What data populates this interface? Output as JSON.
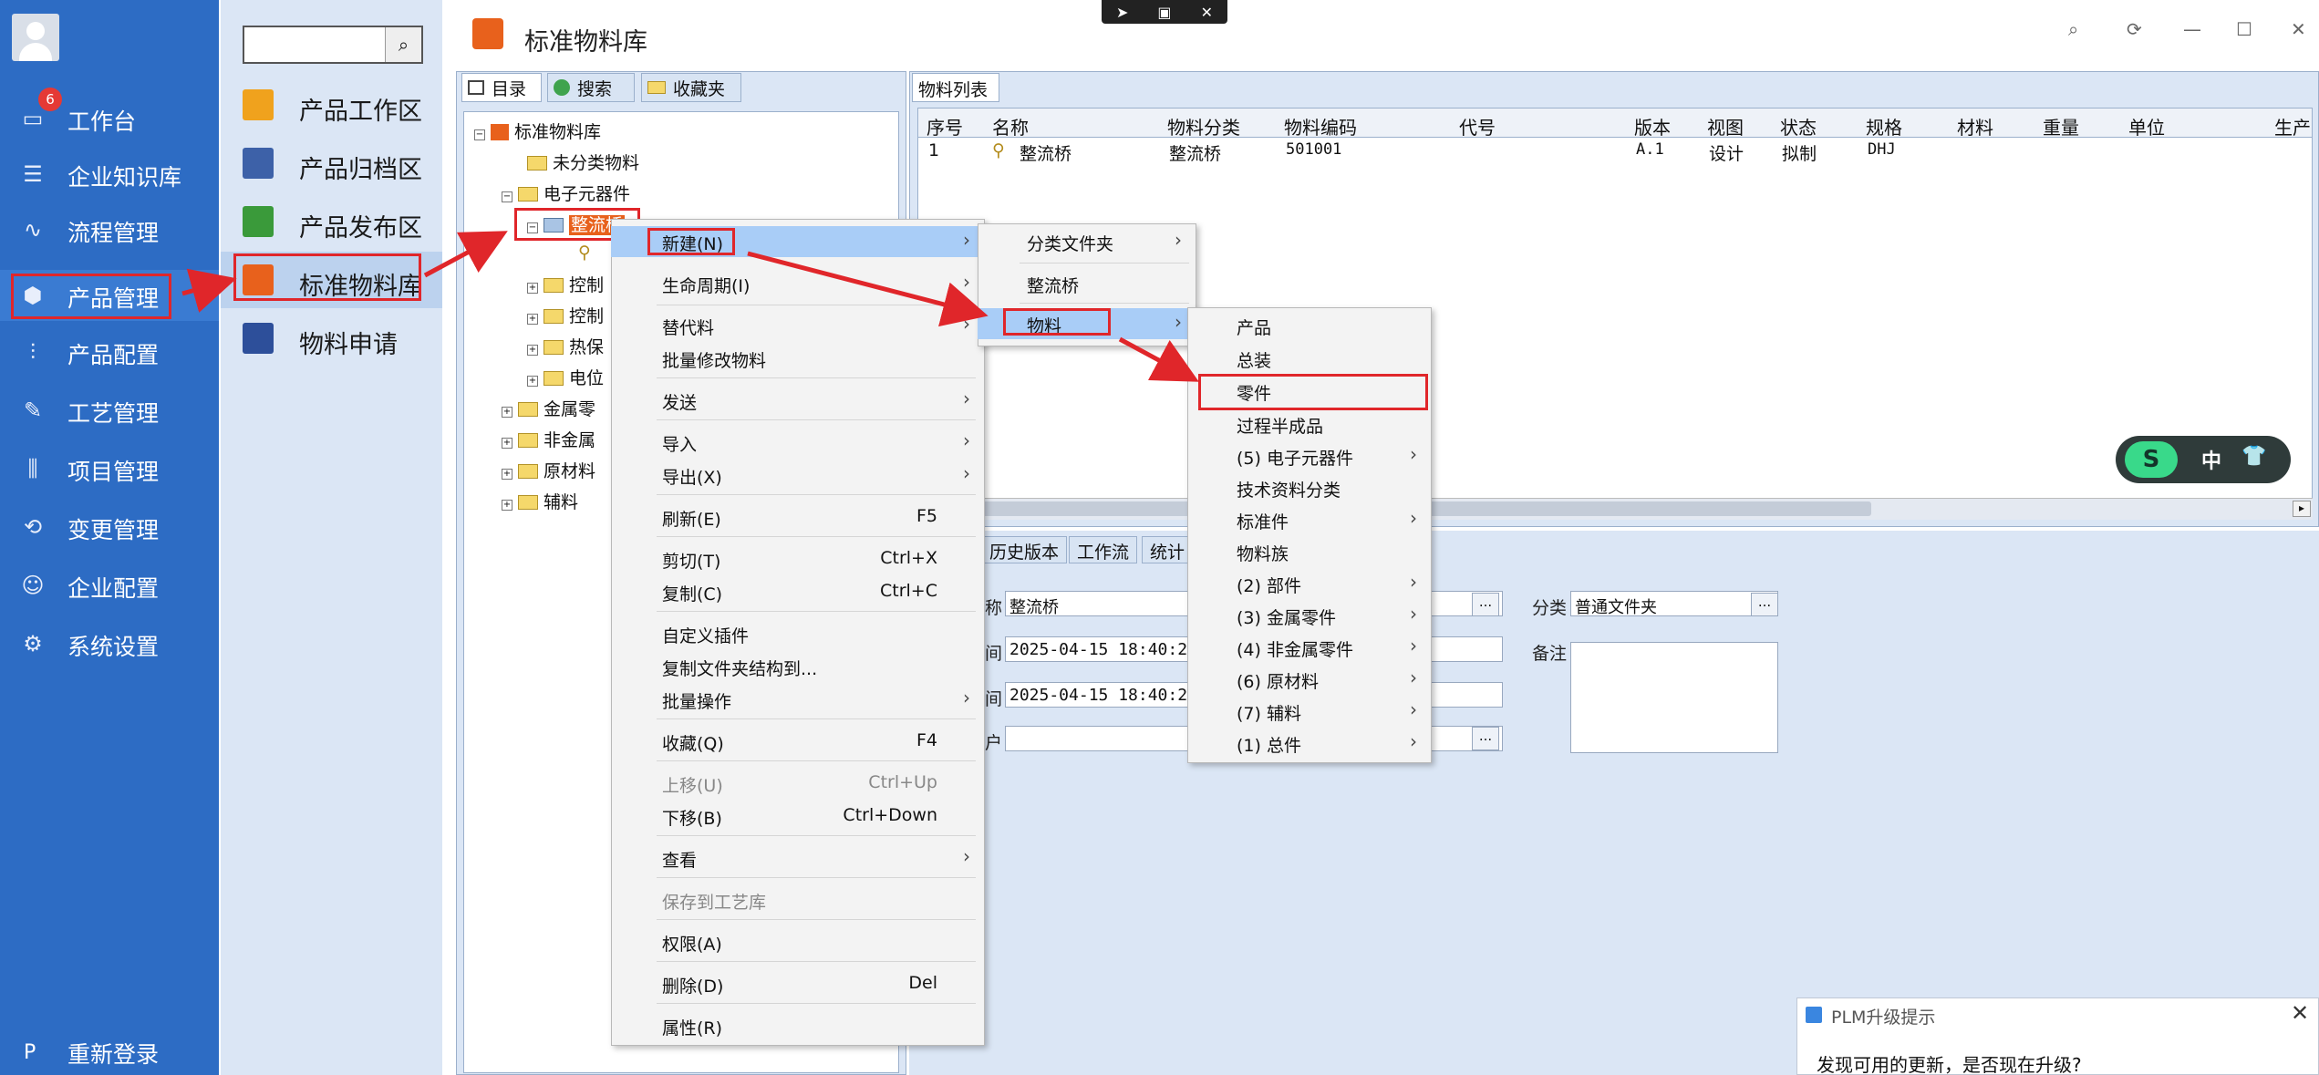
{
  "top_bar": {
    "icons": [
      "send-icon",
      "screen-icon",
      "close-icon"
    ],
    "send": "➤",
    "screen": "▣",
    "close": "✕"
  },
  "left_nav": {
    "badge": "6",
    "items": [
      {
        "label": "工作台",
        "icon": "monitor-icon",
        "glyph": "▭"
      },
      {
        "label": "企业知识库",
        "icon": "book-icon",
        "glyph": "☰"
      },
      {
        "label": "流程管理",
        "icon": "flow-icon",
        "glyph": "∿"
      },
      {
        "label": "产品管理",
        "icon": "cube-icon",
        "glyph": "⬢"
      },
      {
        "label": "产品配置",
        "icon": "sliders-icon",
        "glyph": "⫶"
      },
      {
        "label": "工艺管理",
        "icon": "wrench-icon",
        "glyph": "✎"
      },
      {
        "label": "项目管理",
        "icon": "chart-icon",
        "glyph": "⫼"
      },
      {
        "label": "变更管理",
        "icon": "change-icon",
        "glyph": "⟲"
      },
      {
        "label": "企业配置",
        "icon": "users-icon",
        "glyph": "☺"
      },
      {
        "label": "系统设置",
        "icon": "gear-icon",
        "glyph": "⚙"
      }
    ],
    "logout_icon": "P",
    "logout": "重新登录"
  },
  "sub_nav": {
    "search_value": "",
    "search_icon": "⌕",
    "items": [
      {
        "label": "产品工作区",
        "color": "#f0a21d"
      },
      {
        "label": "产品归档区",
        "color": "#3d61a8"
      },
      {
        "label": "产品发布区",
        "color": "#3a9a3a"
      },
      {
        "label": "标准物料库",
        "color": "#e8611c"
      },
      {
        "label": "物料申请",
        "color": "#2d4f9a"
      }
    ]
  },
  "window": {
    "title": "标准物料库",
    "search": "⌕",
    "refresh": "⟳",
    "minimize": "—",
    "maximize": "☐",
    "close": "✕"
  },
  "tree": {
    "tabs": {
      "dir": "目录",
      "search": "搜索",
      "fav": "收藏夹"
    },
    "root": "标准物料库",
    "nodes": {
      "unclassified": "未分类物料",
      "electronic": "电子元器件",
      "rectifier": "整流桥",
      "ctrl1": "控制",
      "ctrl2": "控制",
      "thermal": "热保",
      "power": "电位",
      "metal": "金属零",
      "nonmetal": "非金属",
      "raw": "原材料",
      "aux": "辅料"
    }
  },
  "list": {
    "tab": "物料列表",
    "columns": [
      "序号",
      "名称",
      "物料分类",
      "物料编码",
      "代号",
      "版本",
      "视图",
      "状态",
      "规格",
      "材料",
      "重量",
      "单位",
      "生产"
    ],
    "rows": [
      [
        "1",
        "整流桥",
        "整流桥",
        "501001",
        "",
        "A.1",
        "设计",
        "拟制",
        "DHJ",
        "",
        "",
        "",
        ""
      ]
    ]
  },
  "detail": {
    "tabs": [
      "历史版本",
      "工作流",
      "统计"
    ],
    "name_label": "称",
    "name_value": "整流桥",
    "created_label": "间",
    "created_value": "2025-04-15 18:40:23",
    "modified_label": "间",
    "modified_value": "2025-04-15 18:40:23",
    "user_label": "户",
    "user_value": "",
    "category_label": "分类",
    "category_value": "普通文件夹",
    "remark_label": "备注",
    "remark_value": "",
    "dots": "..."
  },
  "context_menu": [
    {
      "label": "新建(N)",
      "key": "",
      "arrow": true
    },
    {
      "label": "生命周期(I)",
      "key": "",
      "arrow": true
    },
    {
      "label": "替代料",
      "key": "",
      "arrow": true
    },
    {
      "label": "批量修改物料",
      "key": "",
      "arrow": false
    },
    {
      "label": "发送",
      "key": "",
      "arrow": true
    },
    {
      "label": "导入",
      "key": "",
      "arrow": true
    },
    {
      "label": "导出(X)",
      "key": "",
      "arrow": true
    },
    {
      "label": "刷新(E)",
      "key": "F5",
      "arrow": false
    },
    {
      "label": "剪切(T)",
      "key": "Ctrl+X",
      "arrow": false
    },
    {
      "label": "复制(C)",
      "key": "Ctrl+C",
      "arrow": false
    },
    {
      "label": "自定义插件",
      "key": "",
      "arrow": false
    },
    {
      "label": "复制文件夹结构到...",
      "key": "",
      "arrow": false
    },
    {
      "label": "批量操作",
      "key": "",
      "arrow": true
    },
    {
      "label": "收藏(Q)",
      "key": "F4",
      "arrow": false
    },
    {
      "label": "上移(U)",
      "key": "Ctrl+Up",
      "arrow": false
    },
    {
      "label": "下移(B)",
      "key": "Ctrl+Down",
      "arrow": false
    },
    {
      "label": "查看",
      "key": "",
      "arrow": true
    },
    {
      "label": "保存到工艺库",
      "key": "",
      "arrow": false
    },
    {
      "label": "权限(A)",
      "key": "",
      "arrow": false
    },
    {
      "label": "删除(D)",
      "key": "Del",
      "arrow": false
    },
    {
      "label": "属性(R)",
      "key": "",
      "arrow": false
    }
  ],
  "submenu_new": [
    {
      "label": "分类文件夹",
      "arrow": true
    },
    {
      "label": "整流桥",
      "arrow": false
    },
    {
      "label": "物料",
      "arrow": true
    }
  ],
  "submenu_material": [
    {
      "label": "产品",
      "arrow": false
    },
    {
      "label": "总装",
      "arrow": false
    },
    {
      "label": "零件",
      "arrow": false
    },
    {
      "label": "过程半成品",
      "arrow": false
    },
    {
      "label": "(5) 电子元器件",
      "arrow": true
    },
    {
      "label": "技术资料分类",
      "arrow": false
    },
    {
      "label": "标准件",
      "arrow": true
    },
    {
      "label": "物料族",
      "arrow": false
    },
    {
      "label": "(2) 部件",
      "arrow": true
    },
    {
      "label": "(3) 金属零件",
      "arrow": true
    },
    {
      "label": "(4) 非金属零件",
      "arrow": true
    },
    {
      "label": "(6) 原材料",
      "arrow": true
    },
    {
      "label": "(7) 辅料",
      "arrow": true
    },
    {
      "label": "(1) 总件",
      "arrow": true
    }
  ],
  "arrow_glyph": "›",
  "ime": {
    "logo": "S",
    "lang": "中",
    "skin": "👕"
  },
  "update_popup": {
    "title": "PLM升级提示",
    "message": "发现可用的更新，是否现在升级?",
    "close": "✕"
  },
  "colors": {
    "nav_bg": "#2d6cc4",
    "highlight": "#a9cdf7",
    "annotation": "#e0262a"
  }
}
